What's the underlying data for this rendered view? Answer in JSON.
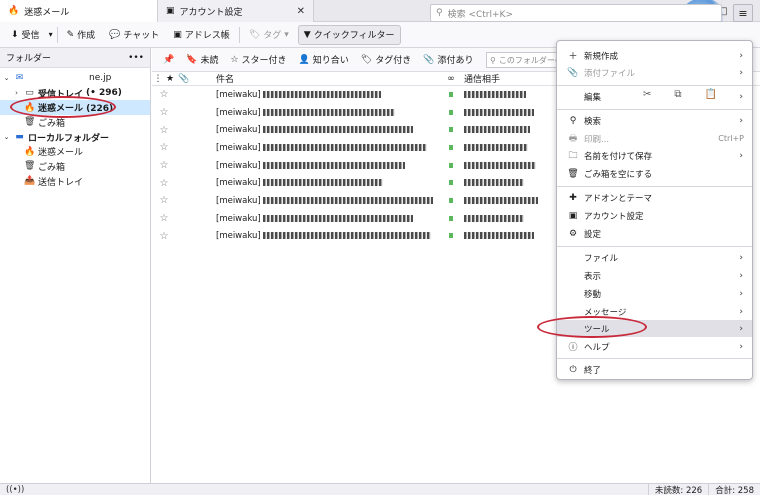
{
  "tabs": [
    {
      "label": "迷惑メール",
      "icon": "junk-flame-icon",
      "active": true
    },
    {
      "label": "アカウント設定",
      "icon": "settings-page-icon",
      "active": false
    }
  ],
  "window_controls": {
    "minimize": "—",
    "maximize": "□",
    "close": "✕"
  },
  "toolbar": {
    "get_mail": "受信",
    "compose": "作成",
    "chat": "チャット",
    "address_book": "アドレス帳",
    "tag": "タグ",
    "quick_filter": "クイックフィルター",
    "search_placeholder": "検索 <Ctrl+K>",
    "menu_glyph": "≡"
  },
  "folder_pane": {
    "header": "フォルダー",
    "more": "•••",
    "account_suffix": "ne.jp",
    "inbox_label": "受信トレイ",
    "inbox_count": "(• 296)",
    "junk_label": "迷惑メール (226)",
    "trash": "ごみ箱",
    "local_folders": "ローカルフォルダー",
    "local_junk": "迷惑メール",
    "local_trash": "ごみ箱",
    "outbox": "送信トレイ"
  },
  "quick_filter": {
    "unread": "未読",
    "starred": "スター付き",
    "contact": "知り合い",
    "tagged": "タグ付き",
    "attachment": "添付あり",
    "folder_filter_placeholder": "このフォルダーの"
  },
  "columns": {
    "subject": "件名",
    "correspondent": "通信相手"
  },
  "messages": [
    {
      "prefix": "[meiwaku]",
      "blur_w": 118,
      "corr_w": 62
    },
    {
      "prefix": "[meiwaku]",
      "blur_w": 132,
      "corr_w": 70
    },
    {
      "prefix": "[meiwaku]",
      "blur_w": 150,
      "corr_w": 66
    },
    {
      "prefix": "[meiwaku]",
      "blur_w": 164,
      "corr_w": 64
    },
    {
      "prefix": "[meiwaku]",
      "blur_w": 142,
      "corr_w": 72
    },
    {
      "prefix": "[meiwaku]",
      "blur_w": 120,
      "corr_w": 60
    },
    {
      "prefix": "[meiwaku]",
      "blur_w": 170,
      "corr_w": 74
    },
    {
      "prefix": "[meiwaku]",
      "blur_w": 150,
      "corr_w": 60
    },
    {
      "prefix": "[meiwaku]",
      "blur_w": 168,
      "corr_w": 70
    }
  ],
  "status": {
    "unread": "未読数: 226",
    "total": "合計: 258"
  },
  "app_menu": {
    "new": "新規作成",
    "attach": "添付ファイル",
    "edit": "編集",
    "find": "検索",
    "print": "印刷...",
    "print_key": "Ctrl+P",
    "save_as": "名前を付けて保存",
    "empty_trash": "ごみ箱を空にする",
    "addons": "アドオンとテーマ",
    "account_settings": "アカウント設定",
    "settings": "設定",
    "file": "ファイル",
    "view": "表示",
    "go": "移動",
    "message": "メッセージ",
    "tools": "ツール",
    "help": "ヘルプ",
    "quit": "終了"
  }
}
